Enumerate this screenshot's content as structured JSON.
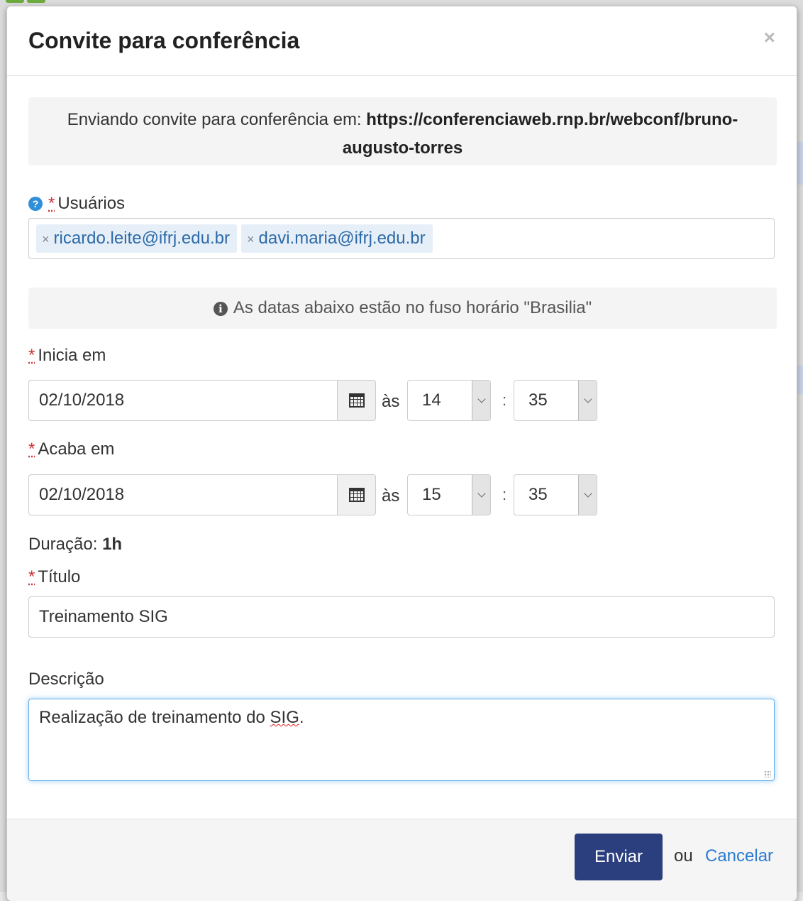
{
  "modal": {
    "title": "Convite para conferência",
    "close_symbol": "×"
  },
  "invite_info": {
    "prefix": "Enviando convite para conferência em: ",
    "url": "https://conferenciaweb.rnp.br/webconf/bruno-augusto-torres"
  },
  "users": {
    "required_mark": "*",
    "label": "Usuários",
    "help_icon": "question-circle-icon",
    "tags": [
      {
        "remove_symbol": "×",
        "label": "ricardo.leite@ifrj.edu.br"
      },
      {
        "remove_symbol": "×",
        "label": "davi.maria@ifrj.edu.br"
      }
    ]
  },
  "timezone_notice": {
    "icon": "info-circle-icon",
    "text": "As datas abaixo estão no fuso horário \"Brasilia\""
  },
  "start": {
    "required_mark": "*",
    "label": "Inicia em",
    "date": "02/10/2018",
    "at_label": "às",
    "hour": "14",
    "separator": ":",
    "minute": "35"
  },
  "end": {
    "required_mark": "*",
    "label": "Acaba em",
    "date": "02/10/2018",
    "at_label": "às",
    "hour": "15",
    "separator": ":",
    "minute": "35"
  },
  "duration": {
    "label": "Duração: ",
    "value": "1h"
  },
  "title_field": {
    "required_mark": "*",
    "label": "Título",
    "value": "Treinamento SIG"
  },
  "description": {
    "label": "Descrição",
    "value_before": "Realização de treinamento do ",
    "value_misspelled": "SIG",
    "value_after": "."
  },
  "footer": {
    "submit_label": "Enviar",
    "or_label": "ou",
    "cancel_label": "Cancelar"
  },
  "colors": {
    "primary_button": "#2b3f7e",
    "link": "#2b7ad0",
    "required": "#cc3333",
    "tag_bg": "#e6eff8"
  }
}
